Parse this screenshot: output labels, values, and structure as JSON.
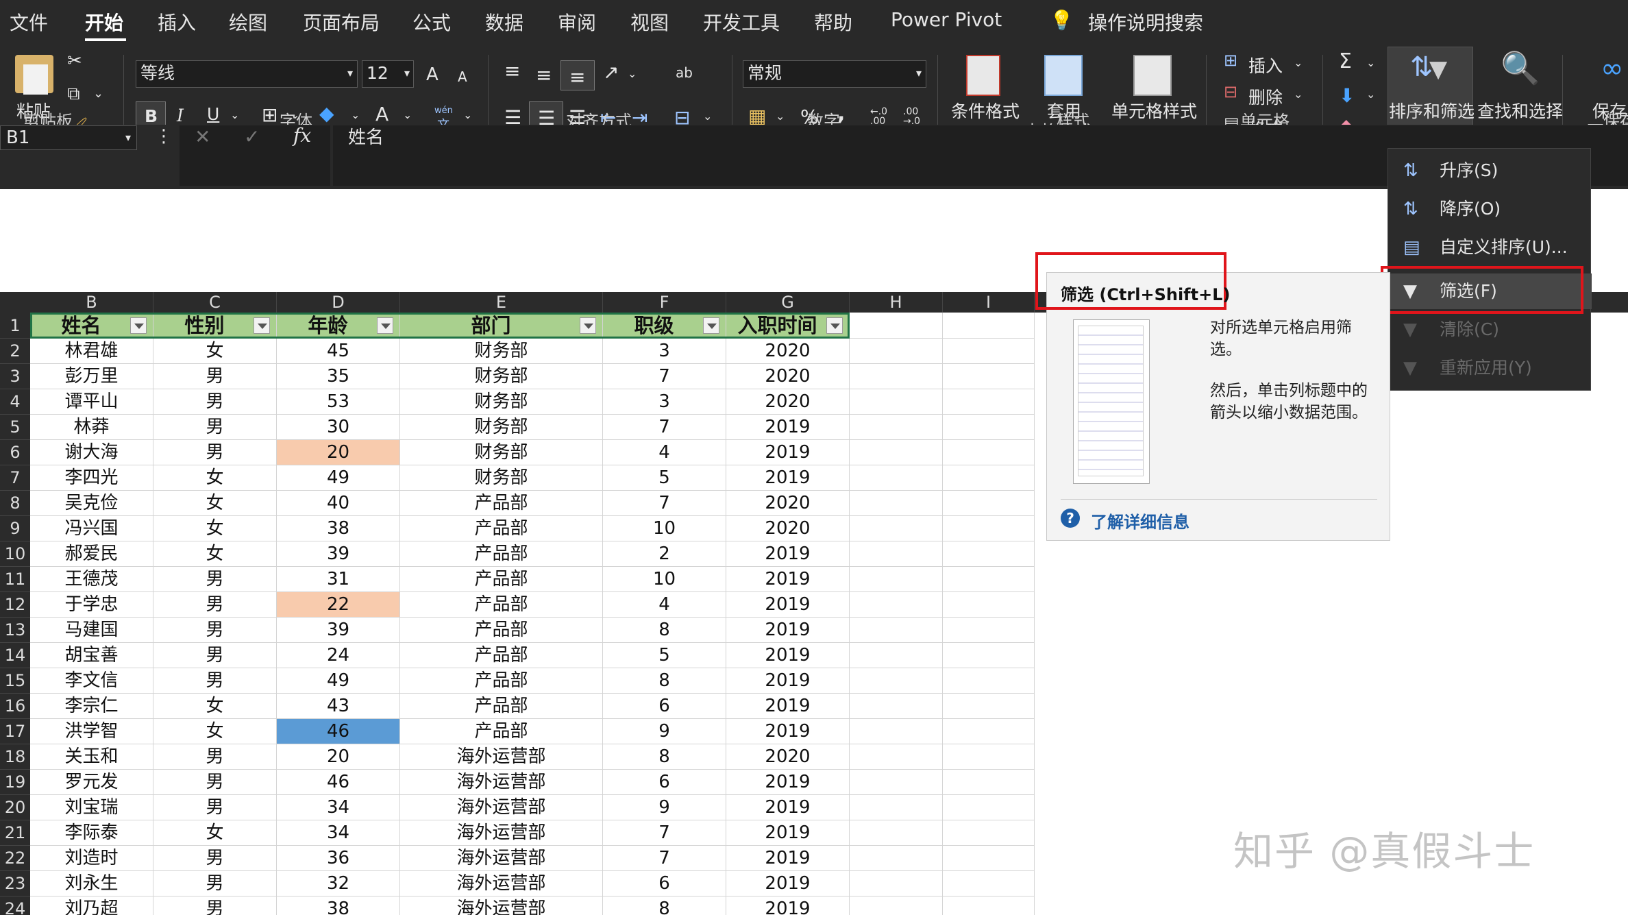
{
  "menu": {
    "tabs": [
      "文件",
      "开始",
      "插入",
      "绘图",
      "页面布局",
      "公式",
      "数据",
      "审阅",
      "视图",
      "开发工具",
      "帮助",
      "Power Pivot"
    ],
    "search": "操作说明搜索"
  },
  "ribbon": {
    "paste": "粘贴",
    "clipboard": "剪贴板",
    "font_name": "等线",
    "font_size": "12",
    "font_inc": "A",
    "font_dec": "A",
    "bold": "B",
    "italic": "I",
    "underline": "U",
    "font_color": "A",
    "wen": "wén",
    "wen2": "文",
    "font": "字体",
    "alignment": "对齐方式",
    "ab": "ab",
    "number_format": "常规",
    "percent": "%",
    "comma": ",",
    "dec_inc": "←.0 .00",
    "dec_dec": ".00 →.0",
    "number": "数字",
    "cond_format": "条件格式",
    "table_format_1": "套用",
    "table_format_2": "表格格式",
    "cell_style": "单元格样式",
    "styles": "样式",
    "insert": "插入",
    "delete": "删除",
    "format": "格式",
    "cells": "单元格",
    "sigma": "Σ",
    "sort_filter": "排序和筛选",
    "find_select": "查找和选择",
    "save_1": "保存",
    "save_2": "百度网",
    "save_3": "保存"
  },
  "formula_bar": {
    "cell_ref": "B1",
    "content": "姓名"
  },
  "sort_menu": {
    "items": [
      {
        "label": "升序(S)",
        "enabled": true
      },
      {
        "label": "降序(O)",
        "enabled": true
      },
      {
        "label": "自定义排序(U)...",
        "enabled": true
      },
      {
        "label": "筛选(F)",
        "enabled": true
      },
      {
        "label": "清除(C)",
        "enabled": false
      },
      {
        "label": "重新应用(Y)",
        "enabled": false
      }
    ]
  },
  "tooltip": {
    "title": "筛选 (Ctrl+Shift+L)",
    "line1": "对所选单元格启用筛选。",
    "line2": "然后，单击列标题中的箭头以缩小数据范围。",
    "link": "了解详细信息"
  },
  "columns": [
    "B",
    "C",
    "D",
    "E",
    "F",
    "G",
    "H",
    "I"
  ],
  "headers": [
    "姓名",
    "性别",
    "年龄",
    "部门",
    "职级",
    "入职时间"
  ],
  "row_numbers": [
    "1",
    "2",
    "3",
    "4",
    "5",
    "6",
    "7",
    "8",
    "9",
    "10",
    "11",
    "12",
    "13",
    "14",
    "15",
    "16",
    "17",
    "18",
    "19",
    "20",
    "21",
    "22",
    "23",
    "24"
  ],
  "rows": [
    [
      "林君雄",
      "女",
      "45",
      "财务部",
      "3",
      "2020"
    ],
    [
      "彭万里",
      "男",
      "35",
      "财务部",
      "7",
      "2020"
    ],
    [
      "谭平山",
      "男",
      "53",
      "财务部",
      "3",
      "2020"
    ],
    [
      "林莽",
      "男",
      "30",
      "财务部",
      "7",
      "2019"
    ],
    [
      "谢大海",
      "男",
      "20",
      "财务部",
      "4",
      "2019"
    ],
    [
      "李四光",
      "女",
      "49",
      "财务部",
      "5",
      "2019"
    ],
    [
      "吴克俭",
      "女",
      "40",
      "产品部",
      "7",
      "2020"
    ],
    [
      "冯兴国",
      "女",
      "38",
      "产品部",
      "10",
      "2020"
    ],
    [
      "郝爱民",
      "女",
      "39",
      "产品部",
      "2",
      "2019"
    ],
    [
      "王德茂",
      "男",
      "31",
      "产品部",
      "10",
      "2019"
    ],
    [
      "于学忠",
      "男",
      "22",
      "产品部",
      "4",
      "2019"
    ],
    [
      "马建国",
      "男",
      "39",
      "产品部",
      "8",
      "2019"
    ],
    [
      "胡宝善",
      "男",
      "24",
      "产品部",
      "5",
      "2019"
    ],
    [
      "李文信",
      "男",
      "49",
      "产品部",
      "8",
      "2019"
    ],
    [
      "李宗仁",
      "女",
      "43",
      "产品部",
      "6",
      "2019"
    ],
    [
      "洪学智",
      "女",
      "46",
      "产品部",
      "9",
      "2019"
    ],
    [
      "关玉和",
      "男",
      "20",
      "海外运营部",
      "8",
      "2020"
    ],
    [
      "罗元发",
      "男",
      "46",
      "海外运营部",
      "6",
      "2019"
    ],
    [
      "刘宝瑞",
      "男",
      "34",
      "海外运营部",
      "9",
      "2019"
    ],
    [
      "李际泰",
      "女",
      "34",
      "海外运营部",
      "7",
      "2019"
    ],
    [
      "刘造时",
      "男",
      "36",
      "海外运营部",
      "7",
      "2019"
    ],
    [
      "刘永生",
      "男",
      "32",
      "海外运营部",
      "6",
      "2019"
    ],
    [
      "刘乃超",
      "男",
      "38",
      "海外运营部",
      "8",
      "2019"
    ]
  ],
  "highlights": {
    "orange": "#f8cbad",
    "blue": "#5b9bd5",
    "header_green": "#a9d08e"
  },
  "watermark": "知乎 @真假斗士"
}
